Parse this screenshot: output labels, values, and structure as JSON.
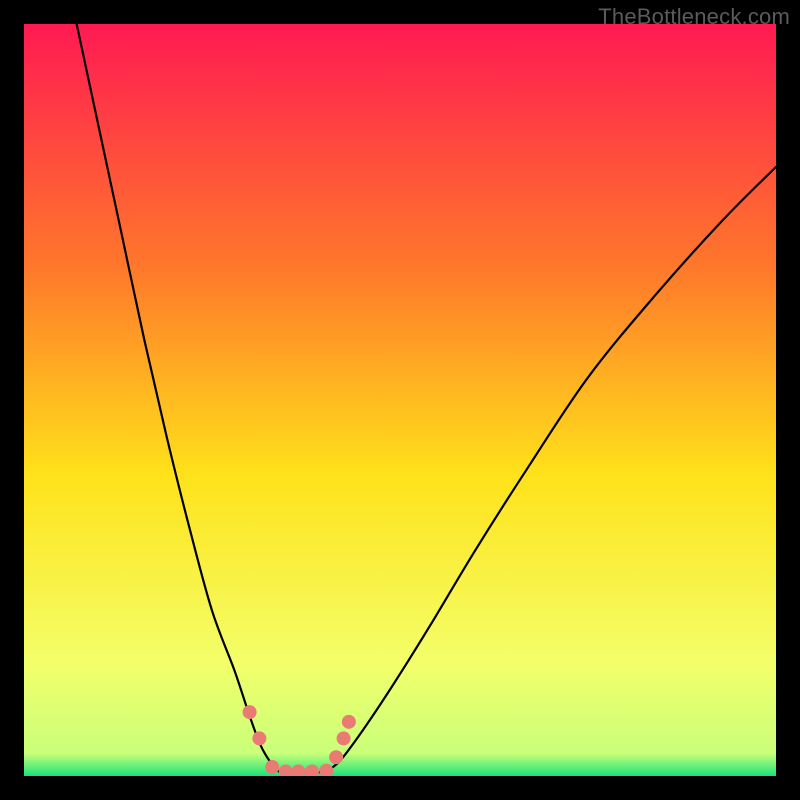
{
  "watermark": "TheBottleneck.com",
  "chart_data": {
    "type": "line",
    "title": "",
    "xlabel": "",
    "ylabel": "",
    "xlim": [
      0,
      100
    ],
    "ylim": [
      0,
      100
    ],
    "background_gradient": {
      "top": "#ff1a52",
      "mid_upper": "#ff7a2a",
      "mid": "#ffe21a",
      "lower": "#f3ff6a",
      "bottom": "#19e37a"
    },
    "series": [
      {
        "name": "left-curve",
        "x": [
          7,
          10,
          13,
          16,
          19,
          22,
          25,
          28,
          30,
          31.5,
          33,
          34
        ],
        "y": [
          100,
          86,
          72,
          58,
          45,
          33,
          22,
          14,
          8,
          4,
          1.5,
          0.5
        ]
      },
      {
        "name": "right-curve",
        "x": [
          40,
          42,
          45,
          49,
          54,
          60,
          67,
          75,
          84,
          93,
          100
        ],
        "y": [
          0.5,
          2,
          6,
          12,
          20,
          30,
          41,
          53,
          64,
          74,
          81
        ]
      }
    ],
    "flat_segment": {
      "name": "trough",
      "x": [
        34,
        40
      ],
      "y": [
        0.5,
        0.5
      ]
    },
    "markers": [
      {
        "x": 30.0,
        "y": 8.5
      },
      {
        "x": 31.3,
        "y": 5.0
      },
      {
        "x": 33.0,
        "y": 1.2
      },
      {
        "x": 34.8,
        "y": 0.6
      },
      {
        "x": 36.5,
        "y": 0.6
      },
      {
        "x": 38.3,
        "y": 0.6
      },
      {
        "x": 40.2,
        "y": 0.7
      },
      {
        "x": 41.5,
        "y": 2.5
      },
      {
        "x": 42.5,
        "y": 5.0
      },
      {
        "x": 43.2,
        "y": 7.2
      }
    ],
    "marker_color": "#e97a74",
    "marker_radius": 7
  }
}
